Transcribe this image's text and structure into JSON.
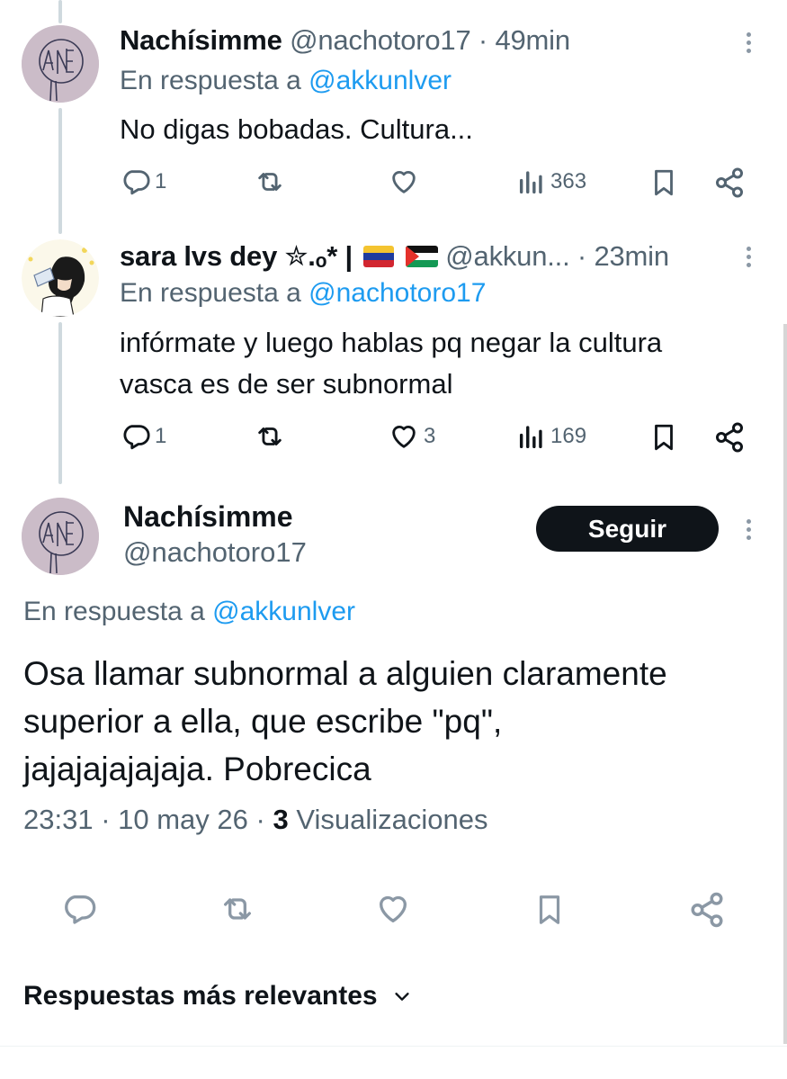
{
  "thread": [
    {
      "name": "Nachísimme",
      "handle": "@nachotoro17",
      "time": "49min",
      "reply_label": "En respuesta a",
      "reply_mention": "@akkunlver",
      "text": "No digas bobadas. Cultura...",
      "actions": {
        "replies": "1",
        "retweets": "",
        "likes": "",
        "views": "363"
      }
    },
    {
      "name": "sara lvs dey ✮.ₒ* |",
      "handle": "@akkun...",
      "time": "23min",
      "flags": [
        "venezuela-flag",
        "palestine-flag"
      ],
      "reply_label": "En respuesta a",
      "reply_mention": "@nachotoro17",
      "text_lines": [
        "infórmate y luego hablas pq negar la cultura",
        "vasca es de ser subnormal"
      ],
      "actions": {
        "replies": "1",
        "retweets": "",
        "likes": "3",
        "views": "169"
      }
    }
  ],
  "main": {
    "name": "Nachísimme",
    "handle": "@nachotoro17",
    "follow_label": "Seguir",
    "reply_label": "En respuesta a",
    "reply_mention": "@akkunlver",
    "text_lines": [
      "Osa llamar subnormal a alguien claramente",
      "superior a ella, que escribe \"pq\",",
      "jajajajajajaja. Pobrecica"
    ],
    "time": "23:31",
    "date": "10 may 26",
    "views_count": "3",
    "views_label": "Visualizaciones"
  },
  "sort": {
    "label": "Respuestas más relevantes"
  },
  "colors": {
    "link": "#1d9bf0",
    "muted": "#536471",
    "text": "#0f1419",
    "button_bg": "#0f1419"
  },
  "icons": [
    "reply-icon",
    "retweet-icon",
    "like-icon",
    "views-icon",
    "bookmark-icon",
    "share-icon",
    "more-icon",
    "chevron-down-icon"
  ]
}
